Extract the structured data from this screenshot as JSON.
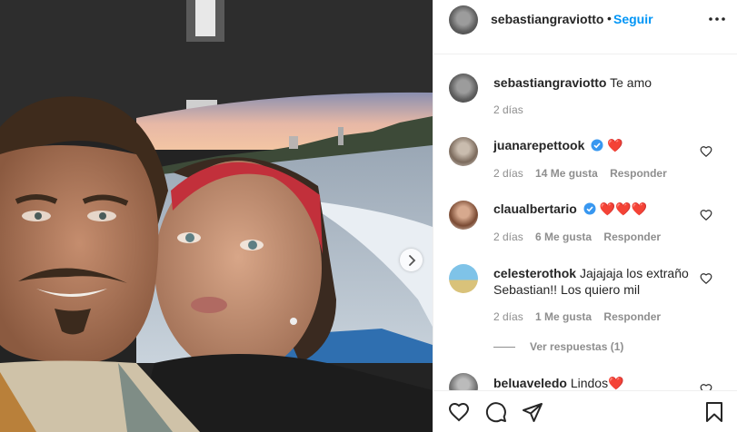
{
  "post": {
    "username": "sebastiangraviotto",
    "separator": "•",
    "follow_label": "Seguir",
    "more_icon": "more-horizontal-icon",
    "next_icon": "chevron-right-icon"
  },
  "colors": {
    "link": "#0095f6",
    "muted": "#8e8e8e",
    "text": "#262626",
    "verified": "#3897f0",
    "heart": "#ed4956"
  },
  "caption": {
    "username": "sebastiangraviotto",
    "text": "Te amo",
    "time": "2 días"
  },
  "comments": [
    {
      "username": "juanarepettook",
      "verified": true,
      "text": "",
      "emoji": "❤️",
      "time": "2 días",
      "likes": "14 Me gusta",
      "reply": "Responder"
    },
    {
      "username": "claualbertario",
      "verified": true,
      "text": "",
      "emoji": "❤️❤️❤️",
      "time": "2 días",
      "likes": "6 Me gusta",
      "reply": "Responder"
    },
    {
      "username": "celesterothok",
      "verified": false,
      "text": "Jajajaja los extraño",
      "text2": "Sebastian!! Los quiero mil",
      "time": "2 días",
      "likes": "1 Me gusta",
      "reply": "Responder",
      "view_replies": "Ver respuestas (1)"
    },
    {
      "username": "beluaveledo",
      "verified": false,
      "text": "Lindos",
      "emoji": "❤️"
    }
  ],
  "actions": {
    "like_icon": "heart-outline-icon",
    "comment_icon": "comment-icon",
    "share_icon": "paper-plane-icon",
    "save_icon": "bookmark-icon"
  }
}
